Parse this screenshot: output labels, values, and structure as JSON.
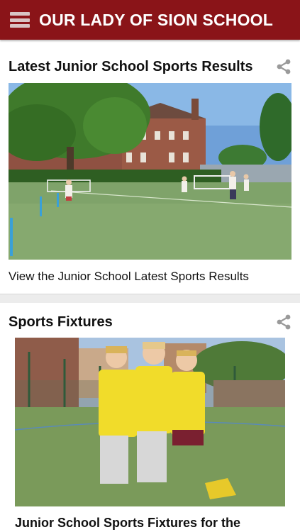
{
  "app": {
    "title": "OUR LADY OF SION SCHOOL",
    "brand_color": "#8a1418"
  },
  "cards": [
    {
      "title": "Latest Junior School Sports Results",
      "image_alt": "Children playing cricket on a green astro pitch in front of a brick school building",
      "link_text": "View the Junior School Latest Sports Results",
      "share_icon": "share-icon"
    },
    {
      "title": "Sports Fixtures",
      "image_alt": "Three boys in yellow mitre bibs standing on a sports court",
      "link_text": "Junior School Sports Fixtures for the",
      "share_icon": "share-icon"
    }
  ]
}
